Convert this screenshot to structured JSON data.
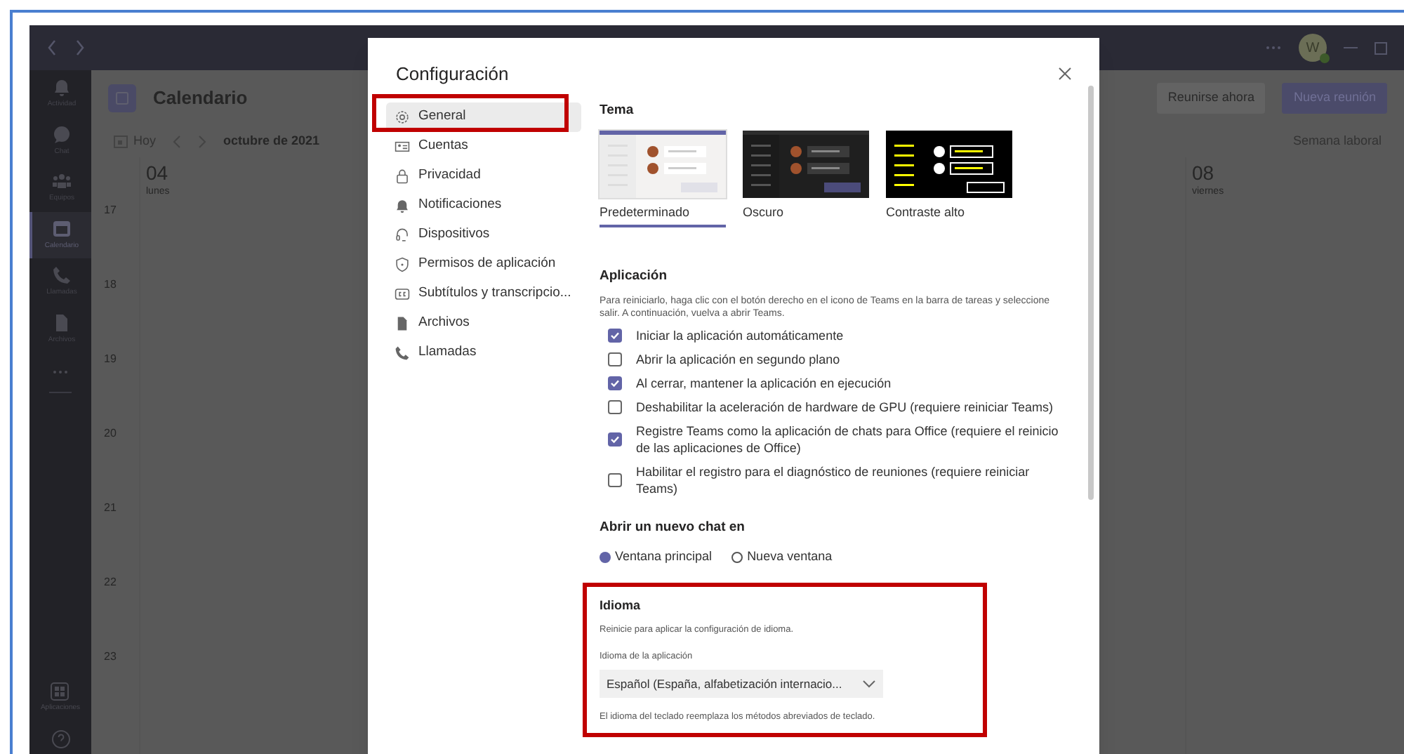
{
  "titlebar": {
    "avatar": "W"
  },
  "rail": [
    {
      "label": "Actividad",
      "selected": false
    },
    {
      "label": "Chat",
      "selected": false
    },
    {
      "label": "Equipos",
      "selected": false
    },
    {
      "label": "Calendario",
      "selected": true
    },
    {
      "label": "Llamadas",
      "selected": false
    },
    {
      "label": "Archivos",
      "selected": false
    }
  ],
  "rail_bottom": {
    "label": "Aplicaciones"
  },
  "calendar": {
    "title": "Calendario",
    "today": "Hoy",
    "month": "octubre de 2021",
    "meet_now": "Reunirse ahora",
    "new_meeting": "Nueva reunión",
    "view": "Semana laboral",
    "days": [
      {
        "number": "04",
        "name": "lunes"
      },
      {
        "number": "08",
        "name": "viernes"
      }
    ],
    "hours": [
      "17",
      "18",
      "19",
      "20",
      "21",
      "22",
      "23"
    ]
  },
  "dialog": {
    "title": "Configuración",
    "nav": [
      {
        "label": "General",
        "selected": true
      },
      {
        "label": "Cuentas",
        "selected": false
      },
      {
        "label": "Privacidad",
        "selected": false
      },
      {
        "label": "Notificaciones",
        "selected": false
      },
      {
        "label": "Dispositivos",
        "selected": false
      },
      {
        "label": "Permisos de aplicación",
        "selected": false
      },
      {
        "label": "Subtítulos y transcripcio...",
        "selected": false
      },
      {
        "label": "Archivos",
        "selected": false
      },
      {
        "label": "Llamadas",
        "selected": false
      }
    ],
    "theme": {
      "heading": "Tema",
      "options": [
        {
          "label": "Predeterminado",
          "kind": "light",
          "selected": true
        },
        {
          "label": "Oscuro",
          "kind": "dark",
          "selected": false
        },
        {
          "label": "Contraste alto",
          "kind": "contrast",
          "selected": false
        }
      ]
    },
    "app": {
      "heading": "Aplicación",
      "description": "Para reiniciarlo, haga clic con el botón derecho en el icono de Teams en la barra de tareas y seleccione salir. A continuación, vuelva a abrir Teams.",
      "options": [
        {
          "label": "Iniciar la aplicación automáticamente",
          "checked": true
        },
        {
          "label": "Abrir la aplicación en segundo plano",
          "checked": false
        },
        {
          "label": "Al cerrar, mantener la aplicación en ejecución",
          "checked": true
        },
        {
          "label": "Deshabilitar la aceleración de hardware de GPU (requiere reiniciar Teams)",
          "checked": false
        },
        {
          "label": "Registre Teams como la aplicación de chats para Office (requiere el reinicio de las aplicaciones de Office)",
          "checked": true
        },
        {
          "label": "Habilitar el registro para el diagnóstico de reuniones (requiere reiniciar Teams)",
          "checked": false
        }
      ]
    },
    "chat": {
      "heading": "Abrir un nuevo chat en",
      "options": [
        {
          "label": "Ventana principal",
          "selected": true
        },
        {
          "label": "Nueva ventana",
          "selected": false
        }
      ]
    },
    "language": {
      "heading": "Idioma",
      "note": "Reinicie para aplicar la configuración de idioma.",
      "field_label": "Idioma de la aplicación",
      "value": "Español (España, alfabetización internacio...",
      "footnote": "El idioma del teclado reemplaza los métodos abreviados de teclado."
    }
  }
}
